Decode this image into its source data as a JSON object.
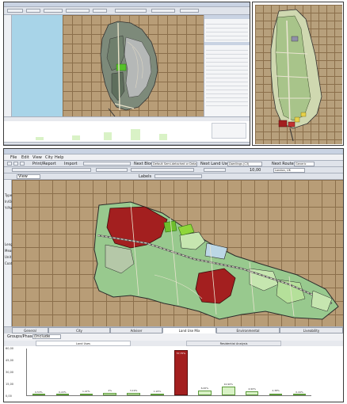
{
  "top_left": {
    "tabs": [
      "",
      "",
      "",
      "",
      "",
      ""
    ],
    "layer_select": "",
    "properties": [
      "",
      "",
      "",
      "",
      "",
      "",
      "",
      "",
      "",
      "",
      "",
      "",
      "",
      ""
    ]
  },
  "bottom": {
    "menu": [
      "File",
      "Edit",
      "View",
      "City",
      "Help"
    ],
    "toolbar": {
      "print_report": "Print/Report",
      "import": "Import",
      "next_block": "Next Block",
      "next_block_value": "Default Semi-detached or Detache",
      "next_land_use": "Next Land Use",
      "next_land_use_value": "Dwellings (C3)",
      "next_route": "Next Route",
      "next_route_value": "Generic",
      "view": "View",
      "labels": "Labels",
      "zoom_value": "10,00",
      "location_value": "London, UK"
    },
    "sidebar_labels": [
      "Type",
      "In/Out",
      "Y-Plat",
      "Length",
      "Meas",
      "Unit",
      "Coats"
    ],
    "tabs": [
      "General",
      "City",
      "Adviser",
      "Land Use Mix",
      "Environmental",
      "Liveability"
    ],
    "active_tab": "Land Use Mix",
    "group_label": "Groups/Phases",
    "group_value": "(Include",
    "subtabs": [
      "Land Uses",
      "Residential Analysis"
    ],
    "chart_ticks": [
      "60,00",
      "45,00",
      "30,00",
      "15,00",
      "0,00"
    ]
  },
  "chart_data": {
    "type": "bar",
    "ylim": [
      0,
      60
    ],
    "ticks": [
      0,
      15,
      30,
      45,
      60
    ],
    "values": [
      0.53,
      0.22,
      1.47,
      2.9,
      3.19,
      1.93,
      57.75,
      6.0,
      10.9,
      4.9,
      2.38,
      0.44
    ],
    "labels": [
      "0,53%",
      "0,22%",
      "1,47%",
      "2%",
      "3,19%",
      "1,93%",
      "57,75%",
      "6,00%",
      "10,90%",
      "4,90%",
      "2,38%",
      "0,44%"
    ],
    "colors": [
      "#d9f2c6",
      "#d9f2c6",
      "#d9f2c6",
      "#d9f2c6",
      "#d9f2c6",
      "#d9f2c6",
      "#a31f1f",
      "#d9f2c6",
      "#d9f2c6",
      "#d9f2c6",
      "#d9f2c6",
      "#d9f2c6"
    ]
  }
}
